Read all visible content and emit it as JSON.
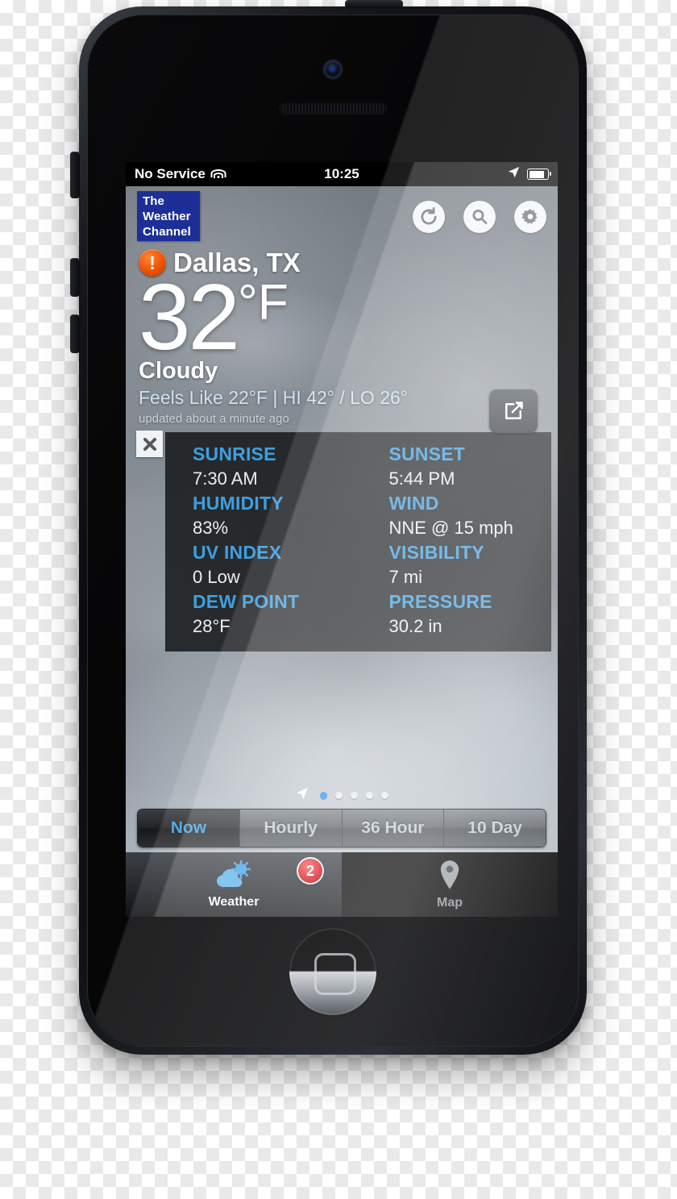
{
  "status_bar": {
    "carrier": "No Service",
    "time": "10:25",
    "wifi_icon": "wifi-icon",
    "location_icon": "location-arrow-icon",
    "battery_icon": "battery-icon"
  },
  "header": {
    "logo_lines": [
      "The",
      "Weather",
      "Channel"
    ],
    "icons": [
      {
        "name": "refresh-icon",
        "label": "Refresh"
      },
      {
        "name": "search-icon",
        "label": "Search"
      },
      {
        "name": "settings-gear-icon",
        "label": "Settings"
      }
    ]
  },
  "current": {
    "alert_icon": "alert-exclamation-icon",
    "location": "Dallas, TX",
    "temperature": "32",
    "unit": "°F",
    "condition": "Cloudy",
    "feels_like": "Feels Like 22°F | HI 42° / LO 26°",
    "updated": "updated about a minute ago",
    "share_icon": "share-icon"
  },
  "details": {
    "close_icon": "close-x-icon",
    "items": [
      {
        "label": "SUNRISE",
        "value": "7:30 AM"
      },
      {
        "label": "SUNSET",
        "value": "5:44 PM"
      },
      {
        "label": "HUMIDITY",
        "value": "83%"
      },
      {
        "label": "WIND",
        "value": "NNE @ 15 mph"
      },
      {
        "label": "UV INDEX",
        "value": "0 Low"
      },
      {
        "label": "VISIBILITY",
        "value": "7 mi"
      },
      {
        "label": "DEW POINT",
        "value": "28°F"
      },
      {
        "label": "PRESSURE",
        "value": "30.2 in"
      }
    ]
  },
  "pager": {
    "location_icon": "location-arrow-icon",
    "total": 5,
    "active_index": 0
  },
  "segmented": {
    "options": [
      "Now",
      "Hourly",
      "36 Hour",
      "10 Day"
    ],
    "selected": "Now"
  },
  "tabbar": {
    "tabs": [
      {
        "label": "Weather",
        "icon": "partly-cloudy-icon",
        "active": true,
        "badge": "2"
      },
      {
        "label": "Map",
        "icon": "map-pin-icon",
        "active": false,
        "badge": ""
      }
    ]
  },
  "colors": {
    "accent_blue": "#3f9fe0",
    "logo_blue": "#1d2f96",
    "alert_orange": "#ea5205",
    "badge_red": "#d40c18",
    "feels_like_blue": "#cfe2f2"
  }
}
